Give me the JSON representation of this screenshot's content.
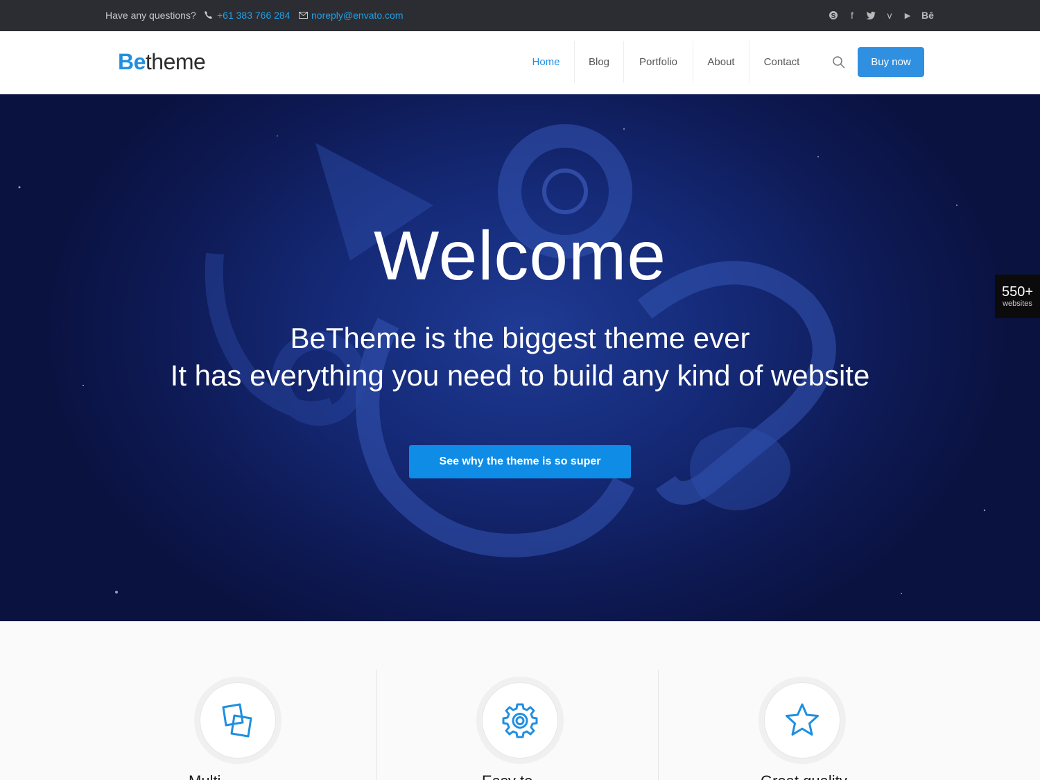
{
  "topbar": {
    "question": "Have any questions?",
    "phone": "+61 383 766 284",
    "email": "noreply@envato.com",
    "social_icons": [
      "skype-icon",
      "facebook-icon",
      "twitter-icon",
      "vimeo-icon",
      "youtube-icon",
      "behance-icon"
    ],
    "social_glyphs": [
      "S",
      "f",
      "t",
      "v",
      "▶",
      "Bē"
    ]
  },
  "header": {
    "logo_be": "Be",
    "logo_theme": "theme",
    "nav": [
      "Home",
      "Blog",
      "Portfolio",
      "About",
      "Contact"
    ],
    "active_nav": "Home",
    "buy_label": "Buy now"
  },
  "hero": {
    "title": "Welcome",
    "subtitle_line1": "BeTheme is the biggest theme ever",
    "subtitle_line2": "It has everything you need to build any kind of website",
    "cta_label": "See why the theme is so super"
  },
  "badge": {
    "count": "550+",
    "label": "websites"
  },
  "features": {
    "items": [
      {
        "icon": "documents-icon",
        "title": "Multi"
      },
      {
        "icon": "gear-icon",
        "title": "Easy to"
      },
      {
        "icon": "star-icon",
        "title": "Great quality"
      }
    ]
  },
  "colors": {
    "accent": "#1f8fe0",
    "topbar_bg": "#2c2d33",
    "hero_bg": "#152a78"
  }
}
